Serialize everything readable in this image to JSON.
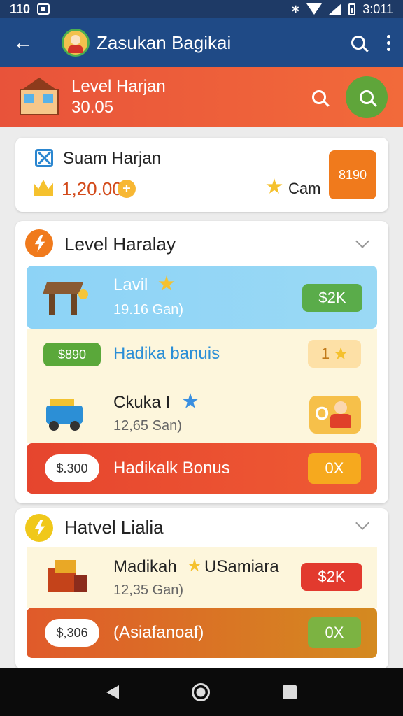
{
  "status": {
    "time": "110",
    "right_time": "3:011"
  },
  "appbar": {
    "title": "Zasukan Bagikai"
  },
  "banner": {
    "line1": "Level Harjan",
    "line2": "30.05"
  },
  "summary": {
    "title": "Suam Harjan",
    "value": "1,20.00",
    "star_label": "Cam",
    "badge": "8190"
  },
  "section1": {
    "title": "Level Haralay",
    "rows": [
      {
        "title": "Lavil",
        "sub": "19.16 Gan)",
        "pill": "$2K"
      },
      {
        "tag": "$890",
        "title": "Hadika banuis",
        "pill": "1"
      },
      {
        "title": "Ckuka I",
        "sub": "12,65 San)"
      },
      {
        "tag": "$.300",
        "title": "Hadikalk Bonus",
        "pill": "0X"
      }
    ]
  },
  "section2": {
    "title": "Hatvel Lialia",
    "rows": [
      {
        "title": "Madikah",
        "title2": "USamiara",
        "sub": "12,35 Gan)",
        "pill": "$2K"
      },
      {
        "tag": "$,306",
        "title": "(Asiafanoaf)",
        "pill": "0X"
      }
    ]
  },
  "colors": {
    "appbar": "#1f4a86",
    "banner": "#e8533a",
    "accent_green": "#5fa53a",
    "accent_orange": "#f07a1c"
  }
}
